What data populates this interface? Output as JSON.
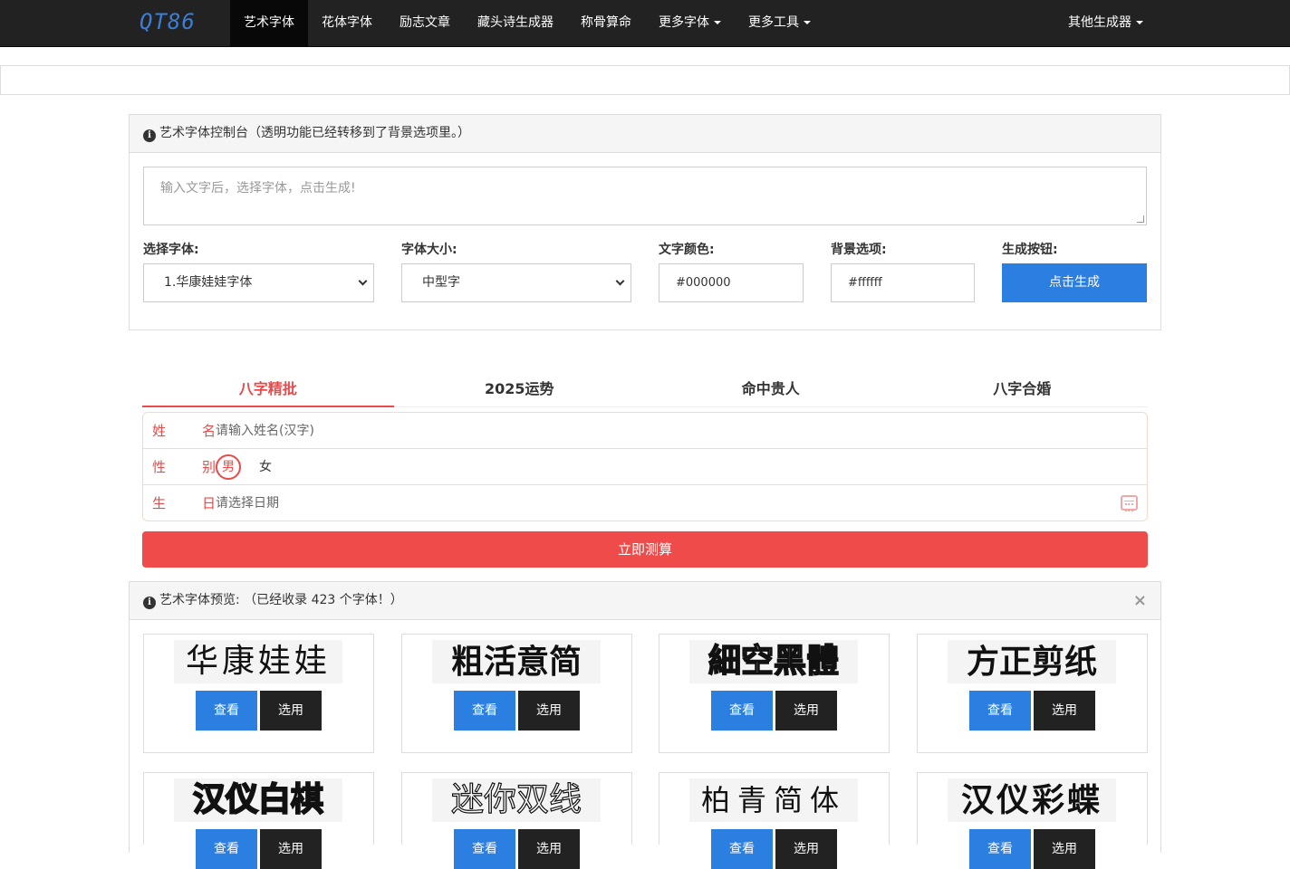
{
  "nav": {
    "brand": "QT86",
    "items": [
      {
        "label": "艺术字体",
        "active": true,
        "dropdown": false
      },
      {
        "label": "花体字体",
        "active": false,
        "dropdown": false
      },
      {
        "label": "励志文章",
        "active": false,
        "dropdown": false
      },
      {
        "label": "藏头诗生成器",
        "active": false,
        "dropdown": false
      },
      {
        "label": "称骨算命",
        "active": false,
        "dropdown": false
      },
      {
        "label": "更多字体",
        "active": false,
        "dropdown": true
      },
      {
        "label": "更多工具",
        "active": false,
        "dropdown": true
      }
    ],
    "right": "其他生成器"
  },
  "console": {
    "title": "艺术字体控制台（透明功能已经转移到了背景选项里。）",
    "textarea_placeholder": "输入文字后，选择字体，点击生成!",
    "font_label": "选择字体:",
    "font_value": "1.华康娃娃字体",
    "size_label": "字体大小:",
    "size_value": "中型字",
    "color_label": "文字颜色:",
    "color_value": "#000000",
    "bg_label": "背景选项:",
    "bg_value": "#ffffff",
    "gen_label": "生成按钮:",
    "gen_button": "点击生成"
  },
  "bazi": {
    "tabs": [
      "八字精批",
      "2025运势",
      "命中贵人",
      "八字合婚"
    ],
    "name_label": [
      "姓",
      "名"
    ],
    "name_placeholder": "请输入姓名(汉字)",
    "gender_label": [
      "性",
      "别"
    ],
    "gender_male": "男",
    "gender_female": "女",
    "birth_label": [
      "生",
      "日"
    ],
    "birth_placeholder": "请选择日期",
    "submit": "立即测算"
  },
  "preview": {
    "title": "艺术字体预览: （已经收录 423 个字体！）",
    "close": "×",
    "view_label": "查看",
    "pick_label": "选用",
    "fonts": [
      "华康娃娃",
      "粗活意简",
      "細空黑體",
      "方正剪纸",
      "汉仪白棋",
      "迷你双线",
      "柏青简体",
      "汉仪彩蝶"
    ]
  },
  "colors": {
    "accent_blue": "#2a7fe0",
    "accent_red": "#ef4b4b",
    "navbar": "#222222"
  }
}
